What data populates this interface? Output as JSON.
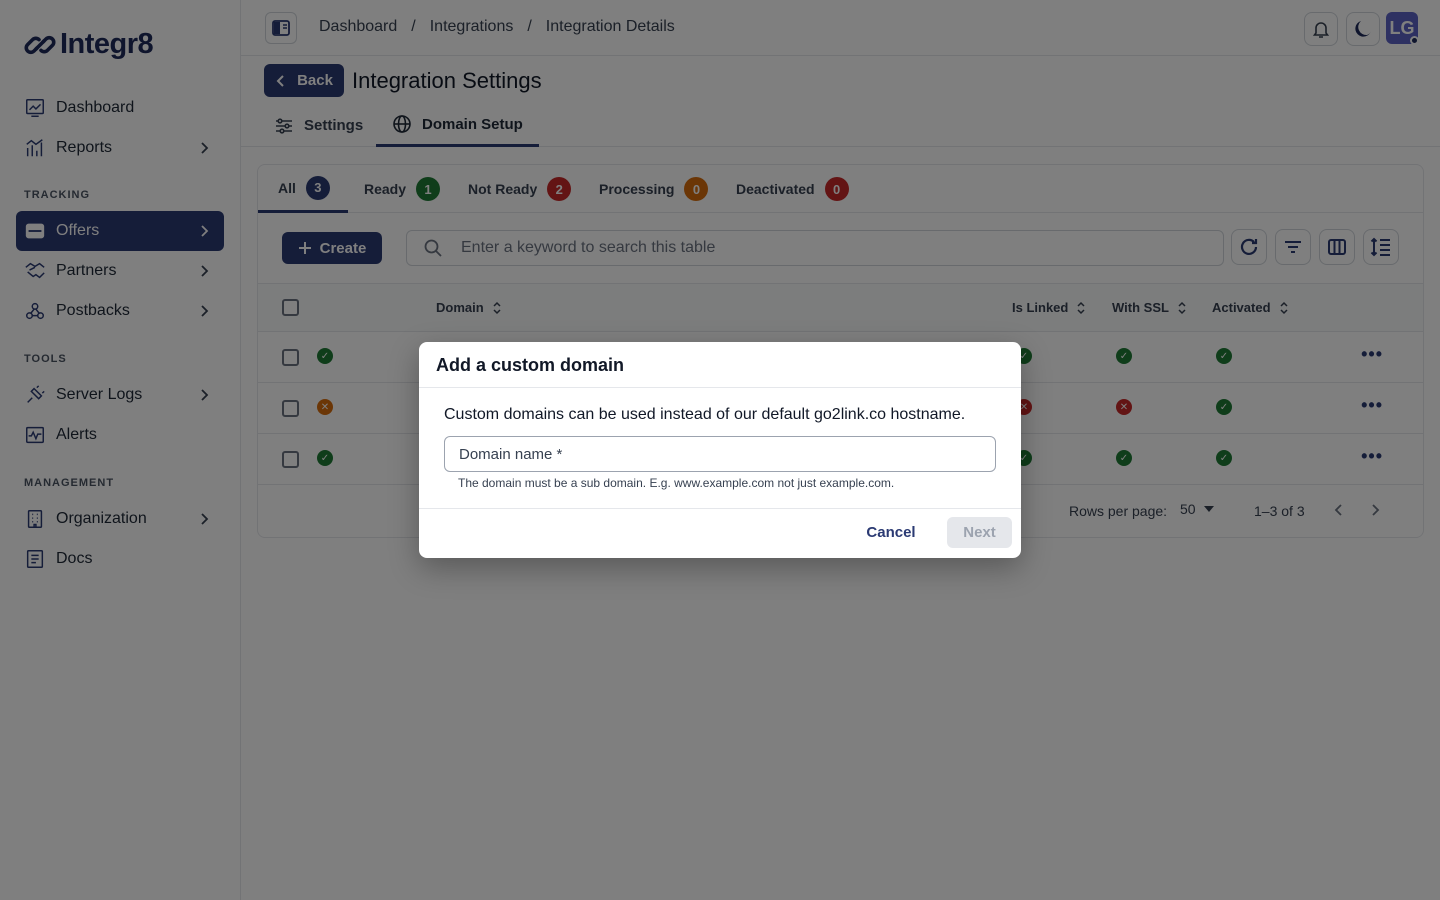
{
  "app": {
    "logo_text": "Integr8"
  },
  "sidebar": {
    "items": [
      {
        "label": "Dashboard",
        "icon": "chart-icon"
      },
      {
        "label": "Reports",
        "icon": "bar-chart-icon"
      }
    ],
    "sections": [
      {
        "label": "TRACKING"
      },
      {
        "label": "TOOLS"
      },
      {
        "label": "MANAGEMENT"
      }
    ],
    "tracking_items": [
      {
        "label": "Offers",
        "icon": "store-icon",
        "active": true
      },
      {
        "label": "Partners",
        "icon": "handshake-icon"
      },
      {
        "label": "Postbacks",
        "icon": "webhook-icon"
      }
    ],
    "tools_items": [
      {
        "label": "Server Logs",
        "icon": "satellite-icon"
      },
      {
        "label": "Alerts",
        "icon": "pulse-icon"
      }
    ],
    "management_items": [
      {
        "label": "Organization",
        "icon": "building-icon"
      },
      {
        "label": "Docs",
        "icon": "document-icon"
      }
    ]
  },
  "topbar": {
    "breadcrumb": [
      "Dashboard",
      "Integrations",
      "Integration Details"
    ],
    "separator": "/",
    "avatar_initials": "LG"
  },
  "page": {
    "back_label": "Back",
    "title": "Integration Settings",
    "tabs": [
      {
        "label": "Settings",
        "icon": "sliders-icon"
      },
      {
        "label": "Domain Setup",
        "icon": "globe-icon",
        "active": true
      }
    ]
  },
  "filters": [
    {
      "label": "All",
      "count": "3",
      "color": "#2b3a73",
      "active": true
    },
    {
      "label": "Ready",
      "count": "1",
      "color": "#1e7a34"
    },
    {
      "label": "Not Ready",
      "count": "2",
      "color": "#c62828"
    },
    {
      "label": "Processing",
      "count": "0",
      "color": "#d66d0c"
    },
    {
      "label": "Deactivated",
      "count": "0",
      "color": "#c62828"
    }
  ],
  "toolbar": {
    "create_label": "Create",
    "search_placeholder": "Enter a keyword to search this table"
  },
  "table": {
    "columns": [
      "Domain",
      "Is Linked",
      "With SSL",
      "Activated"
    ],
    "rows": [
      {
        "status": "ok",
        "is_linked": "ok",
        "with_ssl": "ok",
        "activated": "ok"
      },
      {
        "status": "warn",
        "is_linked": "bad",
        "with_ssl": "bad",
        "activated": "ok"
      },
      {
        "status": "ok",
        "is_linked": "ok",
        "with_ssl": "ok",
        "activated": "ok"
      }
    ],
    "rows_per_page_label": "Rows per page:",
    "rows_per_page": "50",
    "range": "1–3 of 3"
  },
  "modal": {
    "title": "Add a custom domain",
    "description": "Custom domains can be used instead of our default go2link.co hostname.",
    "input_label": "Domain name *",
    "helper": "The domain must be a sub domain. E.g. www.example.com not just example.com.",
    "cancel_label": "Cancel",
    "next_label": "Next"
  }
}
